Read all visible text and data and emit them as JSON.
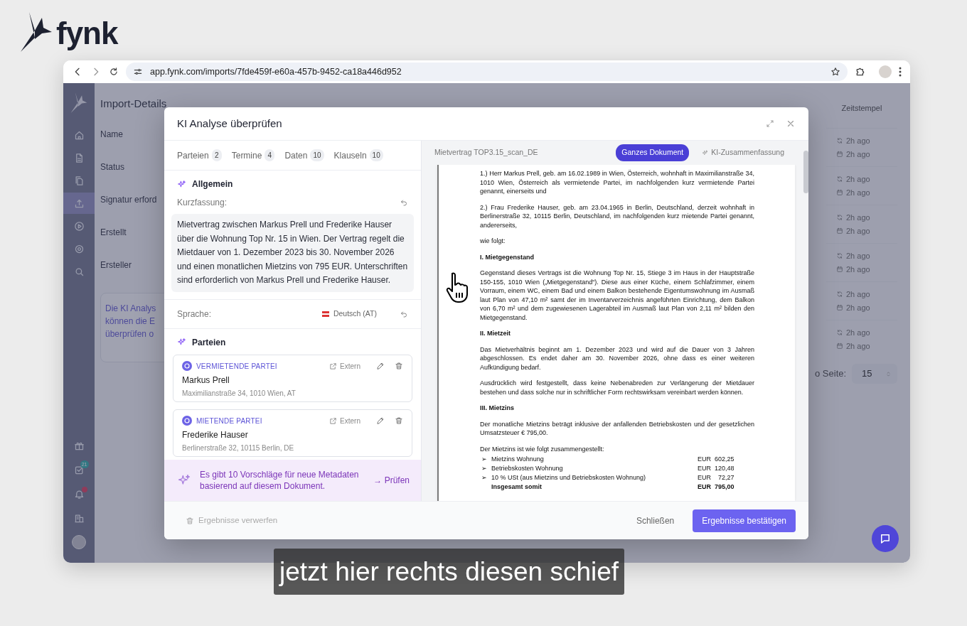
{
  "brand": {
    "name": "fynk"
  },
  "browser": {
    "url": "app.fynk.com/imports/7fde459f-e60a-457b-9452-ca18a446d952"
  },
  "sidebar": {
    "items": [
      {
        "kind": "home",
        "selected": false
      },
      {
        "kind": "file",
        "selected": false
      },
      {
        "kind": "files",
        "selected": false
      },
      {
        "kind": "upload",
        "selected": true
      },
      {
        "kind": "play",
        "selected": false
      },
      {
        "kind": "gear",
        "selected": false
      },
      {
        "kind": "search",
        "selected": false
      }
    ],
    "bottom_items": [
      {
        "kind": "gift"
      },
      {
        "kind": "tasks",
        "badge": "21"
      },
      {
        "kind": "bell",
        "unread": true
      },
      {
        "kind": "building"
      },
      {
        "kind": "avatar"
      }
    ]
  },
  "details": {
    "title": "Import-Details",
    "labels": [
      "Name",
      "Status",
      "Signatur erford",
      "Erstellt",
      "Ersteller"
    ],
    "info_lines": [
      "Die KI Analys",
      "können die E",
      "überprüfen o"
    ]
  },
  "table": {
    "column": "Zeitstempel",
    "rows": [
      {
        "synced": "2h ago",
        "created": "2h ago"
      },
      {
        "synced": "2h ago",
        "created": "2h ago"
      },
      {
        "synced": "2h ago",
        "created": "2h ago"
      },
      {
        "synced": "2h ago",
        "created": "2h ago"
      },
      {
        "synced": "2h ago",
        "created": "2h ago"
      },
      {
        "synced": "2h ago",
        "created": "2h ago"
      }
    ],
    "per_page_label": "o Seite:",
    "per_page": "15"
  },
  "modal": {
    "title": "KI Analyse überprüfen",
    "tabs": [
      {
        "label": "Parteien",
        "count": "2",
        "selected": false
      },
      {
        "label": "Termine",
        "count": "4",
        "selected": false
      },
      {
        "label": "Daten",
        "count": "10",
        "selected": false
      },
      {
        "label": "Klauseln",
        "count": "10",
        "selected": false
      }
    ],
    "general": {
      "title": "Allgemein",
      "summary_label": "Kurzfassung:",
      "summary": "Mietvertrag zwischen Markus Prell und Frederike Hauser über die Wohnung Top Nr. 15 in Wien. Der Vertrag regelt die Mietdauer von 1. Dezember 2023 bis 30. November 2026 und einen monatlichen Mietzins von 795 EUR. Unterschriften sind erforderlich von Markus Prell und Frederike Hauser.",
      "language_label": "Sprache:",
      "language": "Deutsch (AT)"
    },
    "parties": {
      "title": "Parteien",
      "items": [
        {
          "role": "VERMIETENDE PARTEI",
          "name": "Markus Prell",
          "address": "Maximilianstraße 34, 1010 Wien, AT",
          "link": "Extern"
        },
        {
          "role": "MIETENDE PARTEI",
          "name": "Frederike Hauser",
          "address": "Berlinerstraße 32, 10115 Berlin, DE",
          "link": "Extern"
        }
      ]
    },
    "suggestion": {
      "text": "Es gibt 10 Vorschläge für neue Metadaten basierend auf diesem Dokument.",
      "action": "→ Prüfen"
    },
    "document": {
      "name": "Mietvertrag TOP3.15_scan_DE",
      "views": [
        {
          "label": "Ganzes Dokument",
          "selected": true
        },
        {
          "label": "KI-Zusammenfassung",
          "selected": false
        }
      ],
      "blocks": [
        {
          "kind": "para",
          "text": "1.) Herr Markus Prell, geb. am 16.02.1989 in Wien, Österreich, wohnhaft in Maximilianstraße 34, 1010 Wien, Österreich als vermietende Partei, im nachfolgenden kurz vermietende Partei genannt, einerseits und"
        },
        {
          "kind": "para",
          "text": "2.) Frau Frederike Hauser, geb. am 23.04.1965 in Berlin, Deutschland, derzeit wohnhaft in Berlinerstraße 32, 10115 Berlin, Deutschland, im nachfolgenden kurz mietende Partei genannt, andererseits,"
        },
        {
          "kind": "para",
          "text": "wie folgt:"
        },
        {
          "kind": "heading",
          "text": "I. Mietgegenstand"
        },
        {
          "kind": "para",
          "text": "Gegenstand dieses Vertrags ist die Wohnung Top Nr. 15, Stiege 3 im Haus in der Hauptstraße 150-155, 1010 Wien („Mietgegenstand“). Diese aus einer Küche, einem Schlafzimmer, einem Vorraum, einem WC, einem Bad und einem Balkon bestehende Eigentumswohnung im Ausmaß laut Plan von 47,10 m² samt der im Inventarverzeichnis angeführten Einrichtung, dem Balkon von 6,70 m² und dem zugewiesenen Lagerabteil im Ausmaß laut Plan von 2,11 m² bilden den Mietgegenstand."
        },
        {
          "kind": "heading",
          "text": "II. Mietzeit"
        },
        {
          "kind": "para",
          "text": "Das Mietverhältnis beginnt am 1. Dezember 2023 und wird auf die Dauer von 3 Jahren abgeschlossen. Es endet daher am 30. November 2026, ohne dass es einer weiteren Aufkündigung bedarf."
        },
        {
          "kind": "para",
          "text": "Ausdrücklich wird festgestellt, dass keine Nebenabreden zur Verlängerung der Mietdauer bestehen und dass solche nur in schriftlicher Form rechtswirksam vereinbart werden können."
        },
        {
          "kind": "heading",
          "text": "III. Mietzins"
        },
        {
          "kind": "para",
          "text": "Der monatliche Mietzins beträgt inklusive der anfallenden Betriebskosten und der gesetzlichen Umsatzsteuer € 795,00."
        },
        {
          "kind": "lead",
          "text": "Der Mietzins ist wie folgt zusammengestellt:"
        },
        {
          "kind": "item",
          "bullet": "➢",
          "text": "Mietzins Wohnung",
          "amount": "EUR  602,25"
        },
        {
          "kind": "item",
          "bullet": "➢",
          "text": "Betriebskosten Wohnung",
          "amount": "EUR  120,48"
        },
        {
          "kind": "item",
          "bullet": "➢",
          "text": "10 % USt (aus Mietzins und Betriebskosten Wohnung)",
          "amount": "EUR    72,27"
        },
        {
          "kind": "total",
          "text": "Insgesamt somit",
          "amount": "EUR  795,00"
        }
      ]
    },
    "footer": {
      "discard": {
        "label": "Ergebnisse verwerfen",
        "disabled": true
      },
      "close": "Schließen",
      "confirm": "Ergebnisse bestätigen"
    }
  },
  "subtitle": "jetzt hier rechts diesen schief"
}
